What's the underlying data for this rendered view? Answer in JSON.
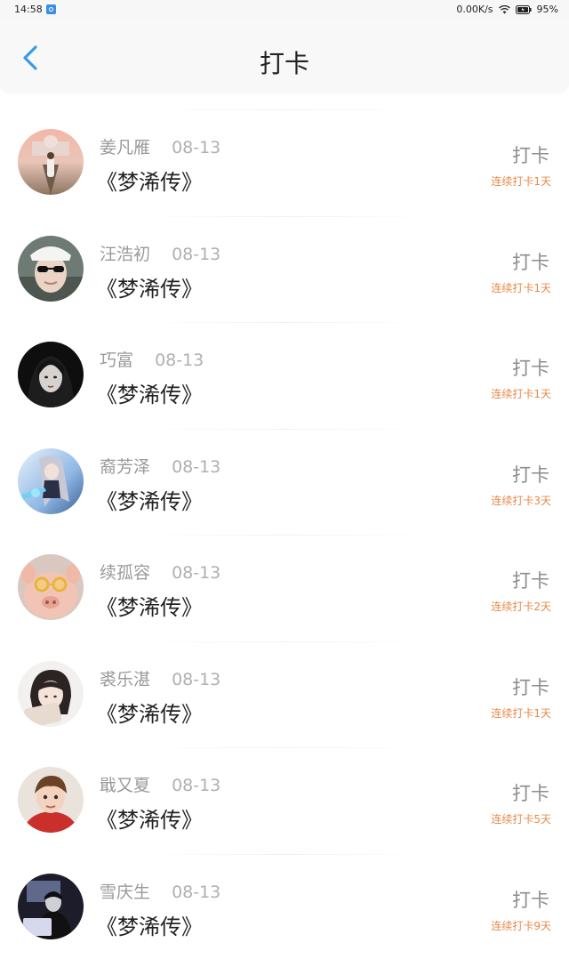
{
  "status_bar": {
    "time": "14:58",
    "network_speed": "0.00K/s",
    "battery": "95%",
    "icons": [
      "app-notification-icon",
      "wifi-icon",
      "battery-icon"
    ]
  },
  "header": {
    "title": "打卡",
    "back_icon": "chevron-left-icon",
    "accent_color": "#3a9be3"
  },
  "entries": [
    {
      "name": "姜凡雁",
      "date": "08-13",
      "book": "《梦浠传》",
      "action": "打卡",
      "streak": "连续打卡1天",
      "avatar": "landscape-photo"
    },
    {
      "name": "汪浩初",
      "date": "08-13",
      "book": "《梦浠传》",
      "action": "打卡",
      "streak": "连续打卡1天",
      "avatar": "person-with-cap"
    },
    {
      "name": "巧富",
      "date": "08-13",
      "book": "《梦浠传》",
      "action": "打卡",
      "streak": "连续打卡1天",
      "avatar": "dark-portrait"
    },
    {
      "name": "裔芳泽",
      "date": "08-13",
      "book": "《梦浠传》",
      "action": "打卡",
      "streak": "连续打卡3天",
      "avatar": "anime-character"
    },
    {
      "name": "续孤容",
      "date": "08-13",
      "book": "《梦浠传》",
      "action": "打卡",
      "streak": "连续打卡2天",
      "avatar": "pig-with-glasses"
    },
    {
      "name": "裘乐湛",
      "date": "08-13",
      "book": "《梦浠传》",
      "action": "打卡",
      "streak": "连续打卡1天",
      "avatar": "girl-portrait"
    },
    {
      "name": "戢又夏",
      "date": "08-13",
      "book": "《梦浠传》",
      "action": "打卡",
      "streak": "连续打卡5天",
      "avatar": "child-portrait"
    },
    {
      "name": "雪庆生",
      "date": "08-13",
      "book": "《梦浠传》",
      "action": "打卡",
      "streak": "连续打卡9天",
      "avatar": "dark-room-portrait"
    }
  ],
  "colors": {
    "streak": "#e8894b",
    "name": "#9a9a9a",
    "title": "#222222"
  }
}
